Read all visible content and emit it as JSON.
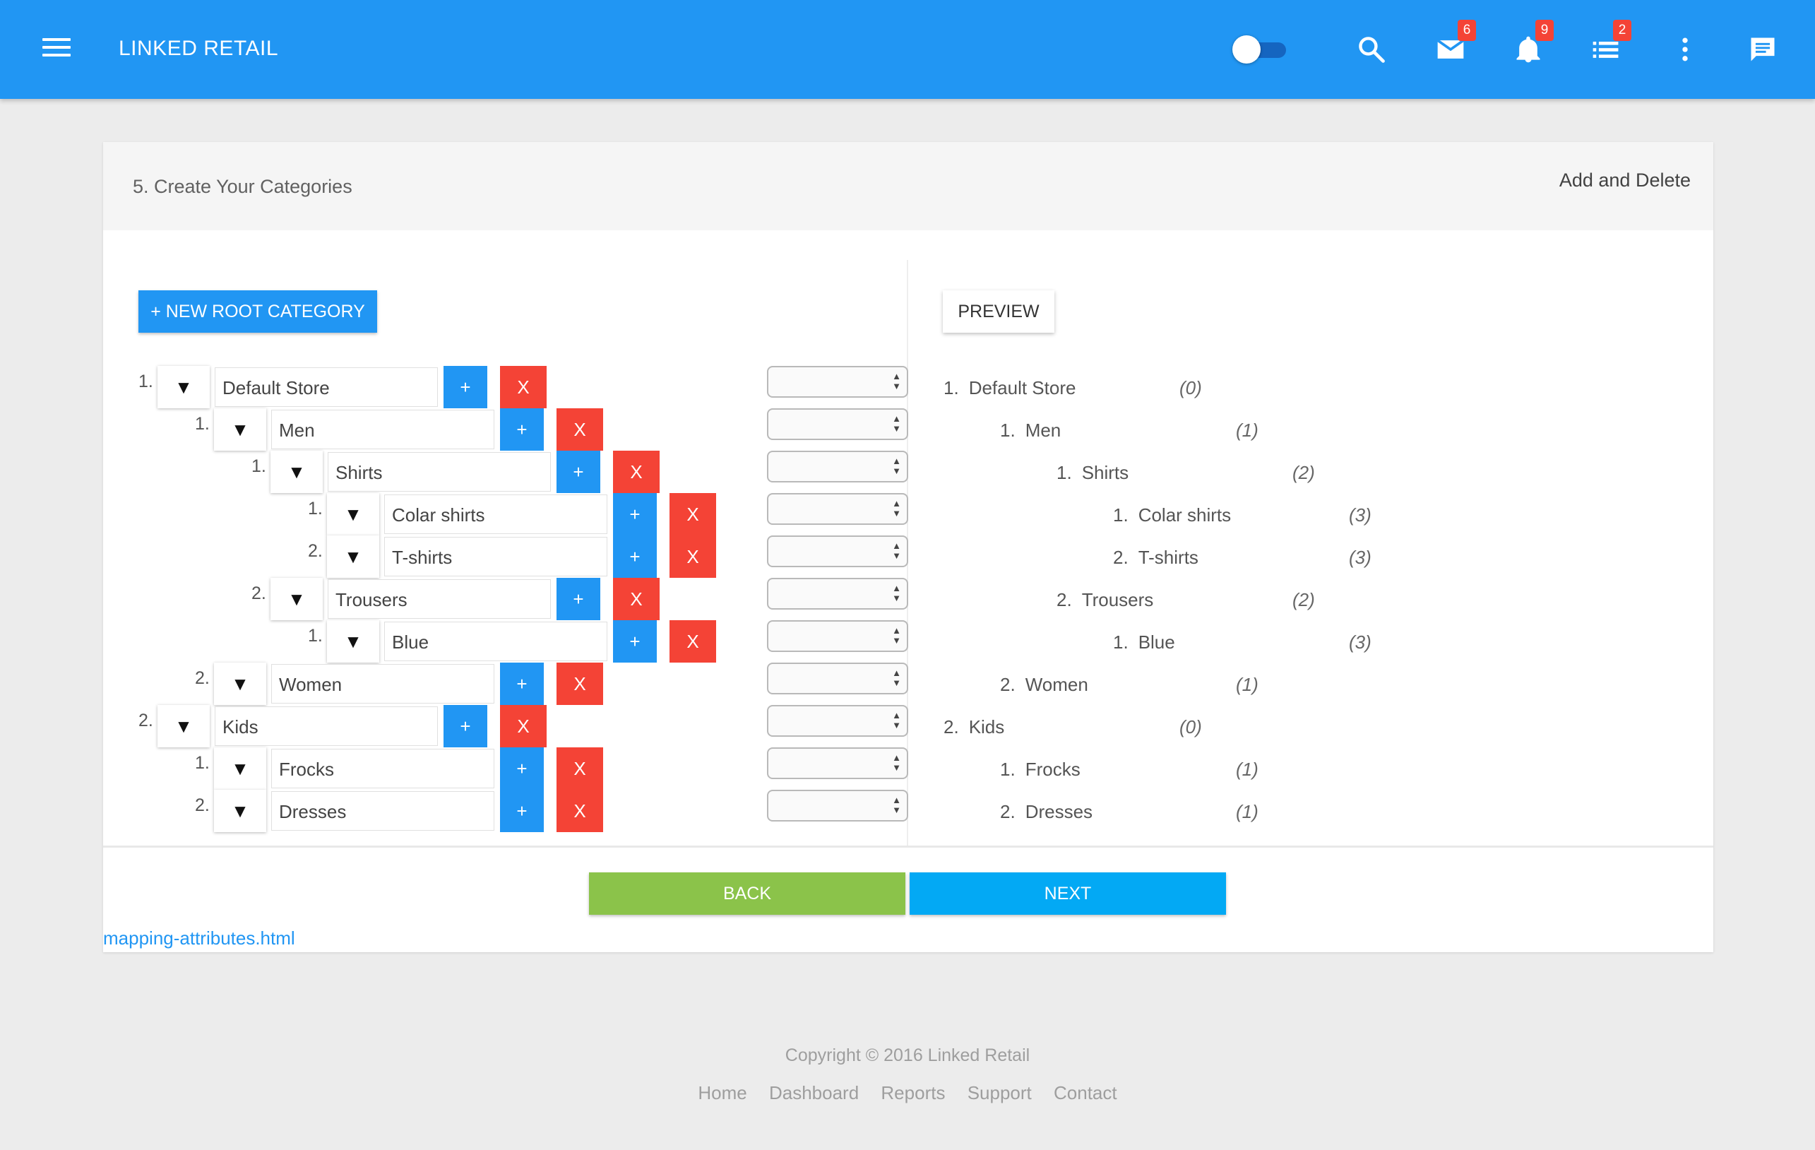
{
  "header": {
    "brand": "LINKED RETAIL",
    "badges": {
      "mail": "6",
      "notifications": "9",
      "tasks": "2"
    }
  },
  "card": {
    "title": "5. Create Your Categories",
    "action": "Add and Delete",
    "new_root_label": "+ NEW ROOT CATEGORY",
    "preview_label": "PREVIEW",
    "add_label": "+",
    "delete_label": "X"
  },
  "tree": [
    {
      "num": "1.",
      "name": "Default Store"
    },
    {
      "num": "1.",
      "name": "Men"
    },
    {
      "num": "1.",
      "name": "Shirts"
    },
    {
      "num": "1.",
      "name": "Colar shirts"
    },
    {
      "num": "2.",
      "name": "T-shirts"
    },
    {
      "num": "2.",
      "name": "Trousers"
    },
    {
      "num": "1.",
      "name": "Blue"
    },
    {
      "num": "2.",
      "name": "Women"
    },
    {
      "num": "2.",
      "name": "Kids"
    },
    {
      "num": "1.",
      "name": "Frocks"
    },
    {
      "num": "2.",
      "name": "Dresses"
    }
  ],
  "preview": [
    {
      "num": "1.",
      "name": "Default Store",
      "count": "(0)"
    },
    {
      "num": "1.",
      "name": "Men",
      "count": "(1)"
    },
    {
      "num": "1.",
      "name": "Shirts",
      "count": "(2)"
    },
    {
      "num": "1.",
      "name": "Colar shirts",
      "count": "(3)"
    },
    {
      "num": "2.",
      "name": "T-shirts",
      "count": "(3)"
    },
    {
      "num": "2.",
      "name": "Trousers",
      "count": "(2)"
    },
    {
      "num": "1.",
      "name": "Blue",
      "count": "(3)"
    },
    {
      "num": "2.",
      "name": "Women",
      "count": "(1)"
    },
    {
      "num": "2.",
      "name": "Kids",
      "count": "(0)"
    },
    {
      "num": "1.",
      "name": "Frocks",
      "count": "(1)"
    },
    {
      "num": "2.",
      "name": "Dresses",
      "count": "(1)"
    }
  ],
  "actions": {
    "back": "BACK",
    "next": "NEXT"
  },
  "link": "mapping-attributes.html",
  "footer": {
    "copyright": "Copyright © 2016 Linked Retail",
    "links": [
      "Home",
      "Dashboard",
      "Reports",
      "Support",
      "Contact"
    ]
  },
  "colors": {
    "primary": "#2196f3",
    "danger": "#f44336",
    "success": "#8bc34a",
    "accent": "#03a9f4"
  }
}
